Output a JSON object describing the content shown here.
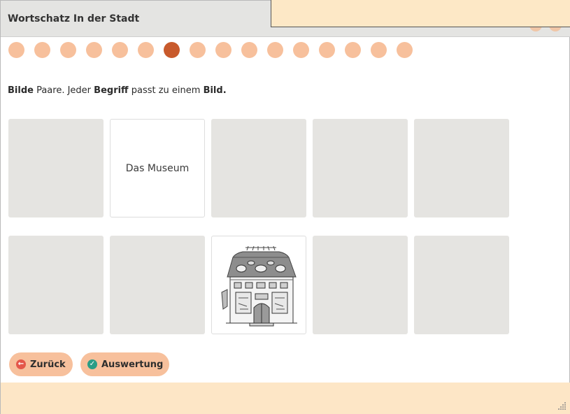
{
  "window": {
    "title": "Wortschatz In der Stadt"
  },
  "progress": {
    "total": 16,
    "current_index": 6
  },
  "instruction": {
    "part1": "Bilde",
    "part2": " Paare. Jeder ",
    "part3": "Begriff",
    "part4": " passt zu einem ",
    "part5": "Bild."
  },
  "cards": {
    "row1": [
      {
        "state": "hidden"
      },
      {
        "state": "revealed",
        "text": "Das Museum"
      },
      {
        "state": "hidden"
      },
      {
        "state": "hidden"
      },
      {
        "state": "hidden"
      }
    ],
    "row2": [
      {
        "state": "hidden"
      },
      {
        "state": "hidden"
      },
      {
        "state": "revealed",
        "image": "museum-building-illustration"
      },
      {
        "state": "hidden"
      },
      {
        "state": "hidden"
      }
    ]
  },
  "buttons": {
    "back_label": "Zurück",
    "back_icon": "arrow-left-circle-icon",
    "evaluate_label": "Auswertung",
    "evaluate_icon": "check-circle-icon"
  },
  "colors": {
    "accent": "#f7c09c",
    "active_dot": "#c85a2c",
    "card_hidden": "#e5e4e1",
    "footer": "#fde6c6",
    "back_icon": "#e4574a",
    "evaluate_icon": "#2a9d86"
  }
}
